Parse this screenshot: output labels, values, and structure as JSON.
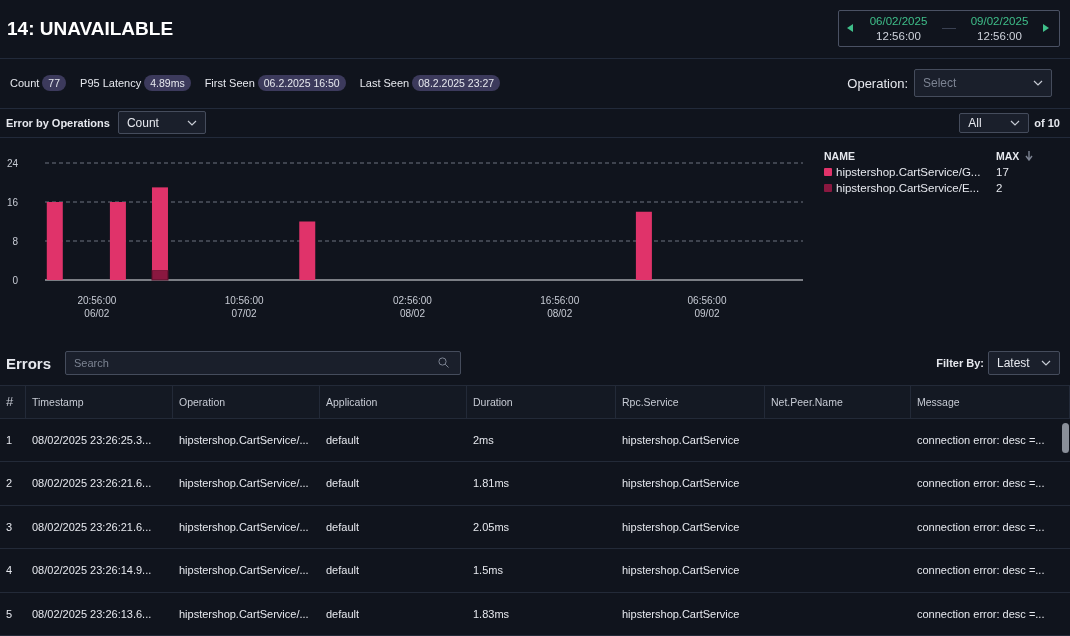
{
  "title": "14: UNAVAILABLE",
  "date_range": {
    "from_date": "06/02/2025",
    "from_time": "12:56:00",
    "to_date": "09/02/2025",
    "to_time": "12:56:00"
  },
  "stats": [
    {
      "label": "Count",
      "value": "77"
    },
    {
      "label": "P95 Latency",
      "value": "4.89ms"
    },
    {
      "label": "First Seen",
      "value": "06.2.2025 16:50"
    },
    {
      "label": "Last Seen",
      "value": "08.2.2025 23:27"
    }
  ],
  "operation_filter": {
    "label": "Operation:",
    "placeholder": "Select"
  },
  "chart_toolbar": {
    "label": "Error by Operations",
    "metric": "Count",
    "range": "All",
    "total": "of 10"
  },
  "chart_data": {
    "type": "bar",
    "stacked": true,
    "ylim": [
      0,
      24
    ],
    "yticks": [
      0,
      8,
      16,
      24
    ],
    "categories": [
      null,
      null,
      null,
      null,
      null,
      "20:56:00 06/02",
      null,
      null,
      null,
      null,
      null,
      null,
      null,
      null,
      null,
      null,
      null,
      null,
      null,
      "10:56:00 07/02",
      null,
      null,
      null,
      null,
      null,
      null,
      null,
      null,
      null,
      null,
      null,
      null,
      null,
      null,
      null,
      "02:56:00 08/02",
      null,
      null,
      null,
      null,
      null,
      null,
      null,
      null,
      null,
      null,
      null,
      null,
      null,
      "16:56:00 08/02",
      null,
      null,
      null,
      null,
      null,
      null,
      null,
      null,
      null,
      null,
      null,
      null,
      null,
      "06:56:00 09/02",
      null,
      null,
      null,
      null,
      null,
      null,
      null,
      null
    ],
    "series": [
      {
        "name": "hipstershop.CartService/E...",
        "color": "#8a1840",
        "values": [
          null,
          null,
          null,
          null,
          null,
          null,
          null,
          null,
          null,
          null,
          null,
          2,
          null,
          null,
          null,
          null,
          null,
          null,
          null,
          null,
          null,
          null,
          null,
          null,
          null,
          null,
          null,
          null,
          null,
          null,
          null,
          null,
          null,
          null,
          null,
          null,
          null,
          null,
          null,
          null,
          null,
          null,
          null,
          null,
          null,
          null,
          null,
          null,
          null,
          null,
          null,
          null,
          null,
          null,
          null,
          null,
          null,
          null,
          null,
          null,
          null,
          null,
          null,
          null,
          null,
          null,
          null,
          null,
          null,
          null,
          null,
          null
        ]
      },
      {
        "name": "hipstershop.CartService/G...",
        "color": "#e0336a",
        "values": [
          null,
          16,
          null,
          null,
          null,
          null,
          null,
          16,
          null,
          null,
          null,
          17,
          null,
          null,
          null,
          null,
          null,
          null,
          null,
          null,
          null,
          null,
          null,
          null,
          null,
          12,
          null,
          null,
          null,
          null,
          null,
          null,
          null,
          null,
          null,
          null,
          null,
          null,
          null,
          null,
          null,
          null,
          null,
          null,
          null,
          null,
          null,
          null,
          null,
          null,
          null,
          null,
          null,
          null,
          null,
          null,
          null,
          14,
          null,
          null,
          null,
          null,
          null,
          null,
          null,
          null,
          null,
          null,
          null,
          null,
          null,
          null
        ]
      }
    ]
  },
  "legend": {
    "columns": [
      "NAME",
      "MAX"
    ],
    "items": [
      {
        "max": "17"
      },
      {
        "max": "2"
      }
    ]
  },
  "errors": {
    "title": "Errors",
    "search_placeholder": "Search",
    "filter_label": "Filter By:",
    "filter_value": "Latest"
  },
  "table": {
    "columns": [
      "#",
      "Timestamp",
      "Operation",
      "Application",
      "Duration",
      "Rpc.Service",
      "Net.Peer.Name",
      "Message"
    ],
    "rows": [
      [
        "1",
        "08/02/2025 23:26:25.3...",
        "hipstershop.CartService/...",
        "default",
        "2ms",
        "hipstershop.CartService",
        "",
        "connection error: desc =..."
      ],
      [
        "2",
        "08/02/2025 23:26:21.6...",
        "hipstershop.CartService/...",
        "default",
        "1.81ms",
        "hipstershop.CartService",
        "",
        "connection error: desc =..."
      ],
      [
        "3",
        "08/02/2025 23:26:21.6...",
        "hipstershop.CartService/...",
        "default",
        "2.05ms",
        "hipstershop.CartService",
        "",
        "connection error: desc =..."
      ],
      [
        "4",
        "08/02/2025 23:26:14.9...",
        "hipstershop.CartService/...",
        "default",
        "1.5ms",
        "hipstershop.CartService",
        "",
        "connection error: desc =..."
      ],
      [
        "5",
        "08/02/2025 23:26:13.6...",
        "hipstershop.CartService/...",
        "default",
        "1.83ms",
        "hipstershop.CartService",
        "",
        "connection error: desc =..."
      ]
    ]
  }
}
